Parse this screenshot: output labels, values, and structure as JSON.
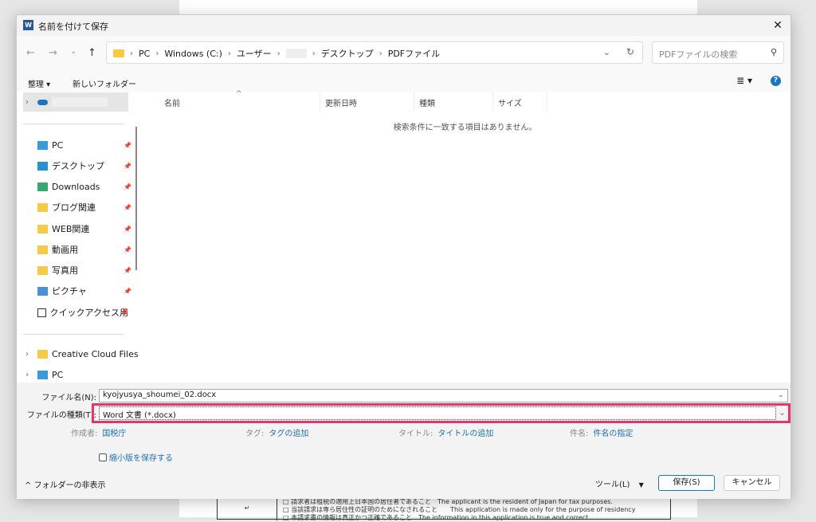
{
  "window": {
    "title": "名前を付けて保存",
    "app_icon": "W"
  },
  "nav": {
    "back": "←",
    "forward": "→",
    "recent": "⌄",
    "up": "↑"
  },
  "address": {
    "crumbs": [
      "PC",
      "Windows (C:)",
      "ユーザー",
      "",
      "デスクトップ",
      "PDFファイル"
    ]
  },
  "search": {
    "placeholder": "PDFファイルの検索"
  },
  "toolbar": {
    "organize": "整理 ▾",
    "new_folder": "新しいフォルダー",
    "help": "?"
  },
  "sidebar": {
    "items": [
      {
        "label": "",
        "icon": "onedrive-icon",
        "selected": true
      },
      {
        "label": "PC",
        "icon": "pc-icon",
        "pinned": true
      },
      {
        "label": "デスクトップ",
        "icon": "desktop-icon",
        "pinned": true
      },
      {
        "label": "Downloads",
        "icon": "downloads-icon",
        "pinned": true
      },
      {
        "label": "ブログ関連",
        "icon": "folder-icon",
        "pinned": true
      },
      {
        "label": "WEB関連",
        "icon": "folder-icon",
        "pinned": true
      },
      {
        "label": "動画用",
        "icon": "folder-icon",
        "pinned": true
      },
      {
        "label": "写真用",
        "icon": "folder-icon",
        "pinned": true
      },
      {
        "label": "ピクチャ",
        "icon": "pictures-icon",
        "pinned": true
      },
      {
        "label": "クイックアクセス用",
        "icon": "quick-access-icon",
        "pinned": true
      },
      {
        "label": "Creative Cloud Files",
        "icon": "folder-icon"
      },
      {
        "label": "PC",
        "icon": "pc-icon"
      }
    ]
  },
  "list": {
    "columns": [
      "名前",
      "更新日時",
      "種類",
      "サイズ"
    ],
    "empty_message": "検索条件に一致する項目はありません。"
  },
  "form": {
    "filename_label": "ファイル名(N):",
    "filename_value": "kyojyusya_shoumei_02.docx",
    "filetype_label": "ファイルの種類(T):",
    "filetype_value": "Word 文書 (*.docx)",
    "meta": [
      {
        "k": "作成者:",
        "v": "国税庁"
      },
      {
        "k": "タグ:",
        "v": "タグの追加"
      },
      {
        "k": "タイトル:",
        "v": "タイトルの追加"
      },
      {
        "k": "件名:",
        "v": "件名の指定"
      }
    ],
    "thumbnail_label": "縮小版を保存する",
    "thumbnail_checked": false,
    "highlight_color": "#e8336d"
  },
  "footer": {
    "hide_folders": "フォルダーの非表示",
    "tools": "ツール(L)",
    "save": "保存(S)",
    "cancel": "キャンセル"
  },
  "background_doc": {
    "lines": [
      "□ 請求者は租税の適用上日本国の居住者であること　The applicant is the resident of Japan for tax purposes.",
      "□ 当該請求は専ら居住性の証明のためになされること　　This application is made only for the purpose of residency",
      "□ 本請求書の情報は真正かつ正確であること　The information in this application is true and correct."
    ]
  }
}
